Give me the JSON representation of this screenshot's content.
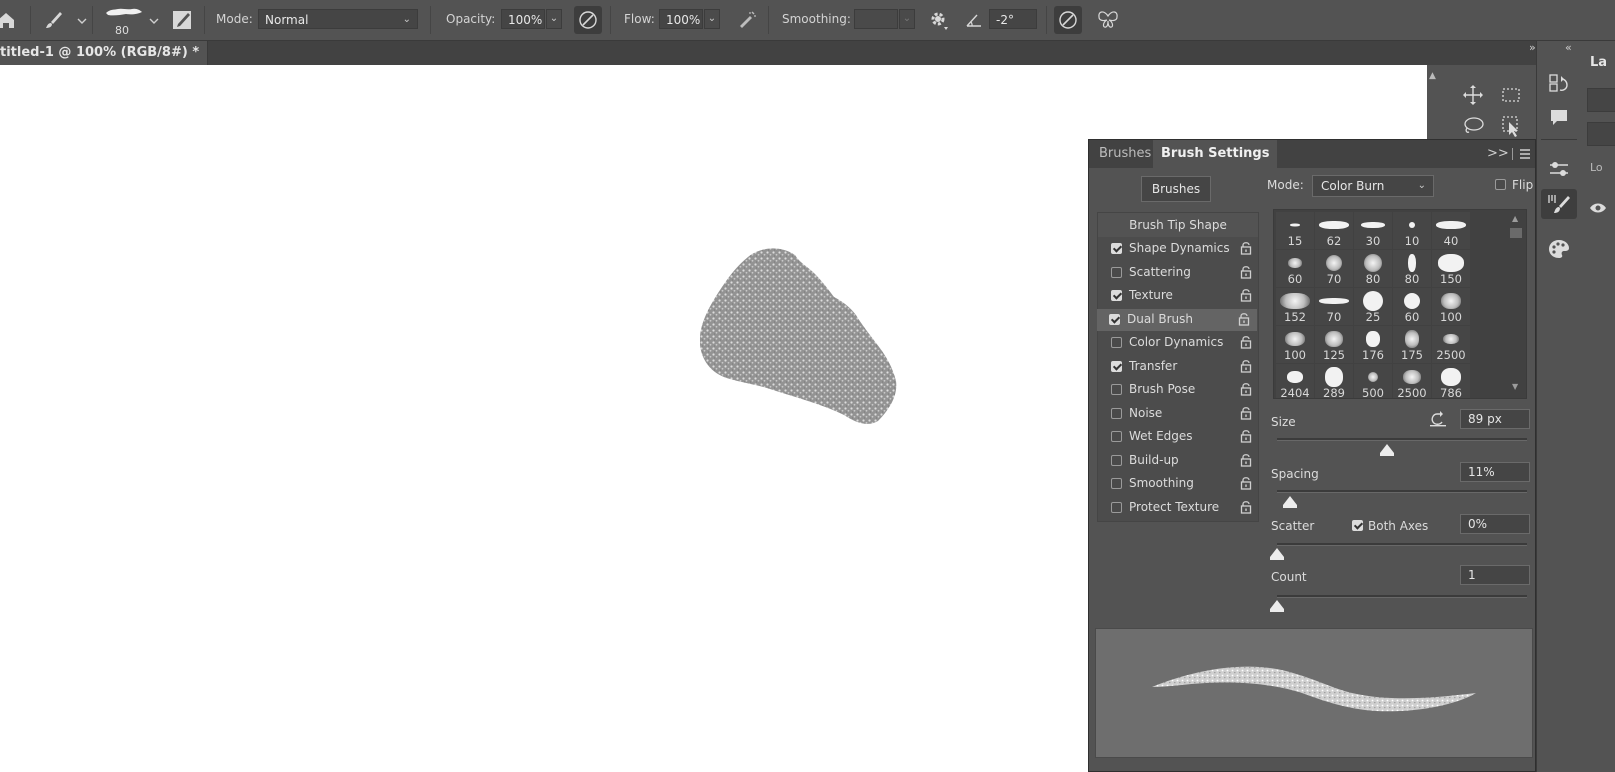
{
  "optionsBar": {
    "brushSize": "80",
    "modeLabel": "Mode:",
    "modeValue": "Normal",
    "opacityLabel": "Opacity:",
    "opacityValue": "100%",
    "flowLabel": "Flow:",
    "flowValue": "100%",
    "smoothingLabel": "Smoothing:",
    "smoothingValue": "",
    "angleValue": "-2°"
  },
  "document": {
    "tabTitle": "titled-1 @ 100% (RGB/8#) *",
    "closeGlyph": "×"
  },
  "panel": {
    "tabs": [
      "Brushes",
      "Brush Settings"
    ],
    "brushesButton": "Brushes",
    "modeLabel": "Mode:",
    "modeValue": "Color Burn",
    "flipLabel": "Flip",
    "tipShapeHeader": "Brush Tip Shape",
    "options": [
      {
        "label": "Shape Dynamics",
        "checked": true
      },
      {
        "label": "Scattering",
        "checked": false
      },
      {
        "label": "Texture",
        "checked": true
      },
      {
        "label": "Dual Brush",
        "checked": true
      },
      {
        "label": "Color Dynamics",
        "checked": false
      },
      {
        "label": "Transfer",
        "checked": true
      },
      {
        "label": "Brush Pose",
        "checked": false
      },
      {
        "label": "Noise",
        "checked": false
      },
      {
        "label": "Wet Edges",
        "checked": false
      },
      {
        "label": "Build-up",
        "checked": false
      },
      {
        "label": "Smoothing",
        "checked": false
      },
      {
        "label": "Protect Texture",
        "checked": false
      }
    ],
    "selectedOption": "Dual Brush",
    "presetSizes": [
      "15",
      "62",
      "30",
      "10",
      "40",
      "60",
      "70",
      "80",
      "80",
      "150",
      "152",
      "70",
      "25",
      "60",
      "100",
      "100",
      "125",
      "176",
      "175",
      "2500",
      "2404",
      "289",
      "500",
      "2500",
      "786"
    ],
    "sizeLabel": "Size",
    "sizeValue": "89 px",
    "sizeLevel": 0.44,
    "spacingLabel": "Spacing",
    "spacingValue": "11%",
    "spacingLevel": 0.05,
    "scatterLabel": "Scatter",
    "bothAxesLabel": "Both Axes",
    "bothAxesChecked": true,
    "scatterValue": "0%",
    "scatterLevel": 0,
    "countLabel": "Count",
    "countValue": "1",
    "countLevel": 0
  },
  "layersPanel": {
    "titleFragment": "La",
    "lockFragment": "Lo"
  }
}
